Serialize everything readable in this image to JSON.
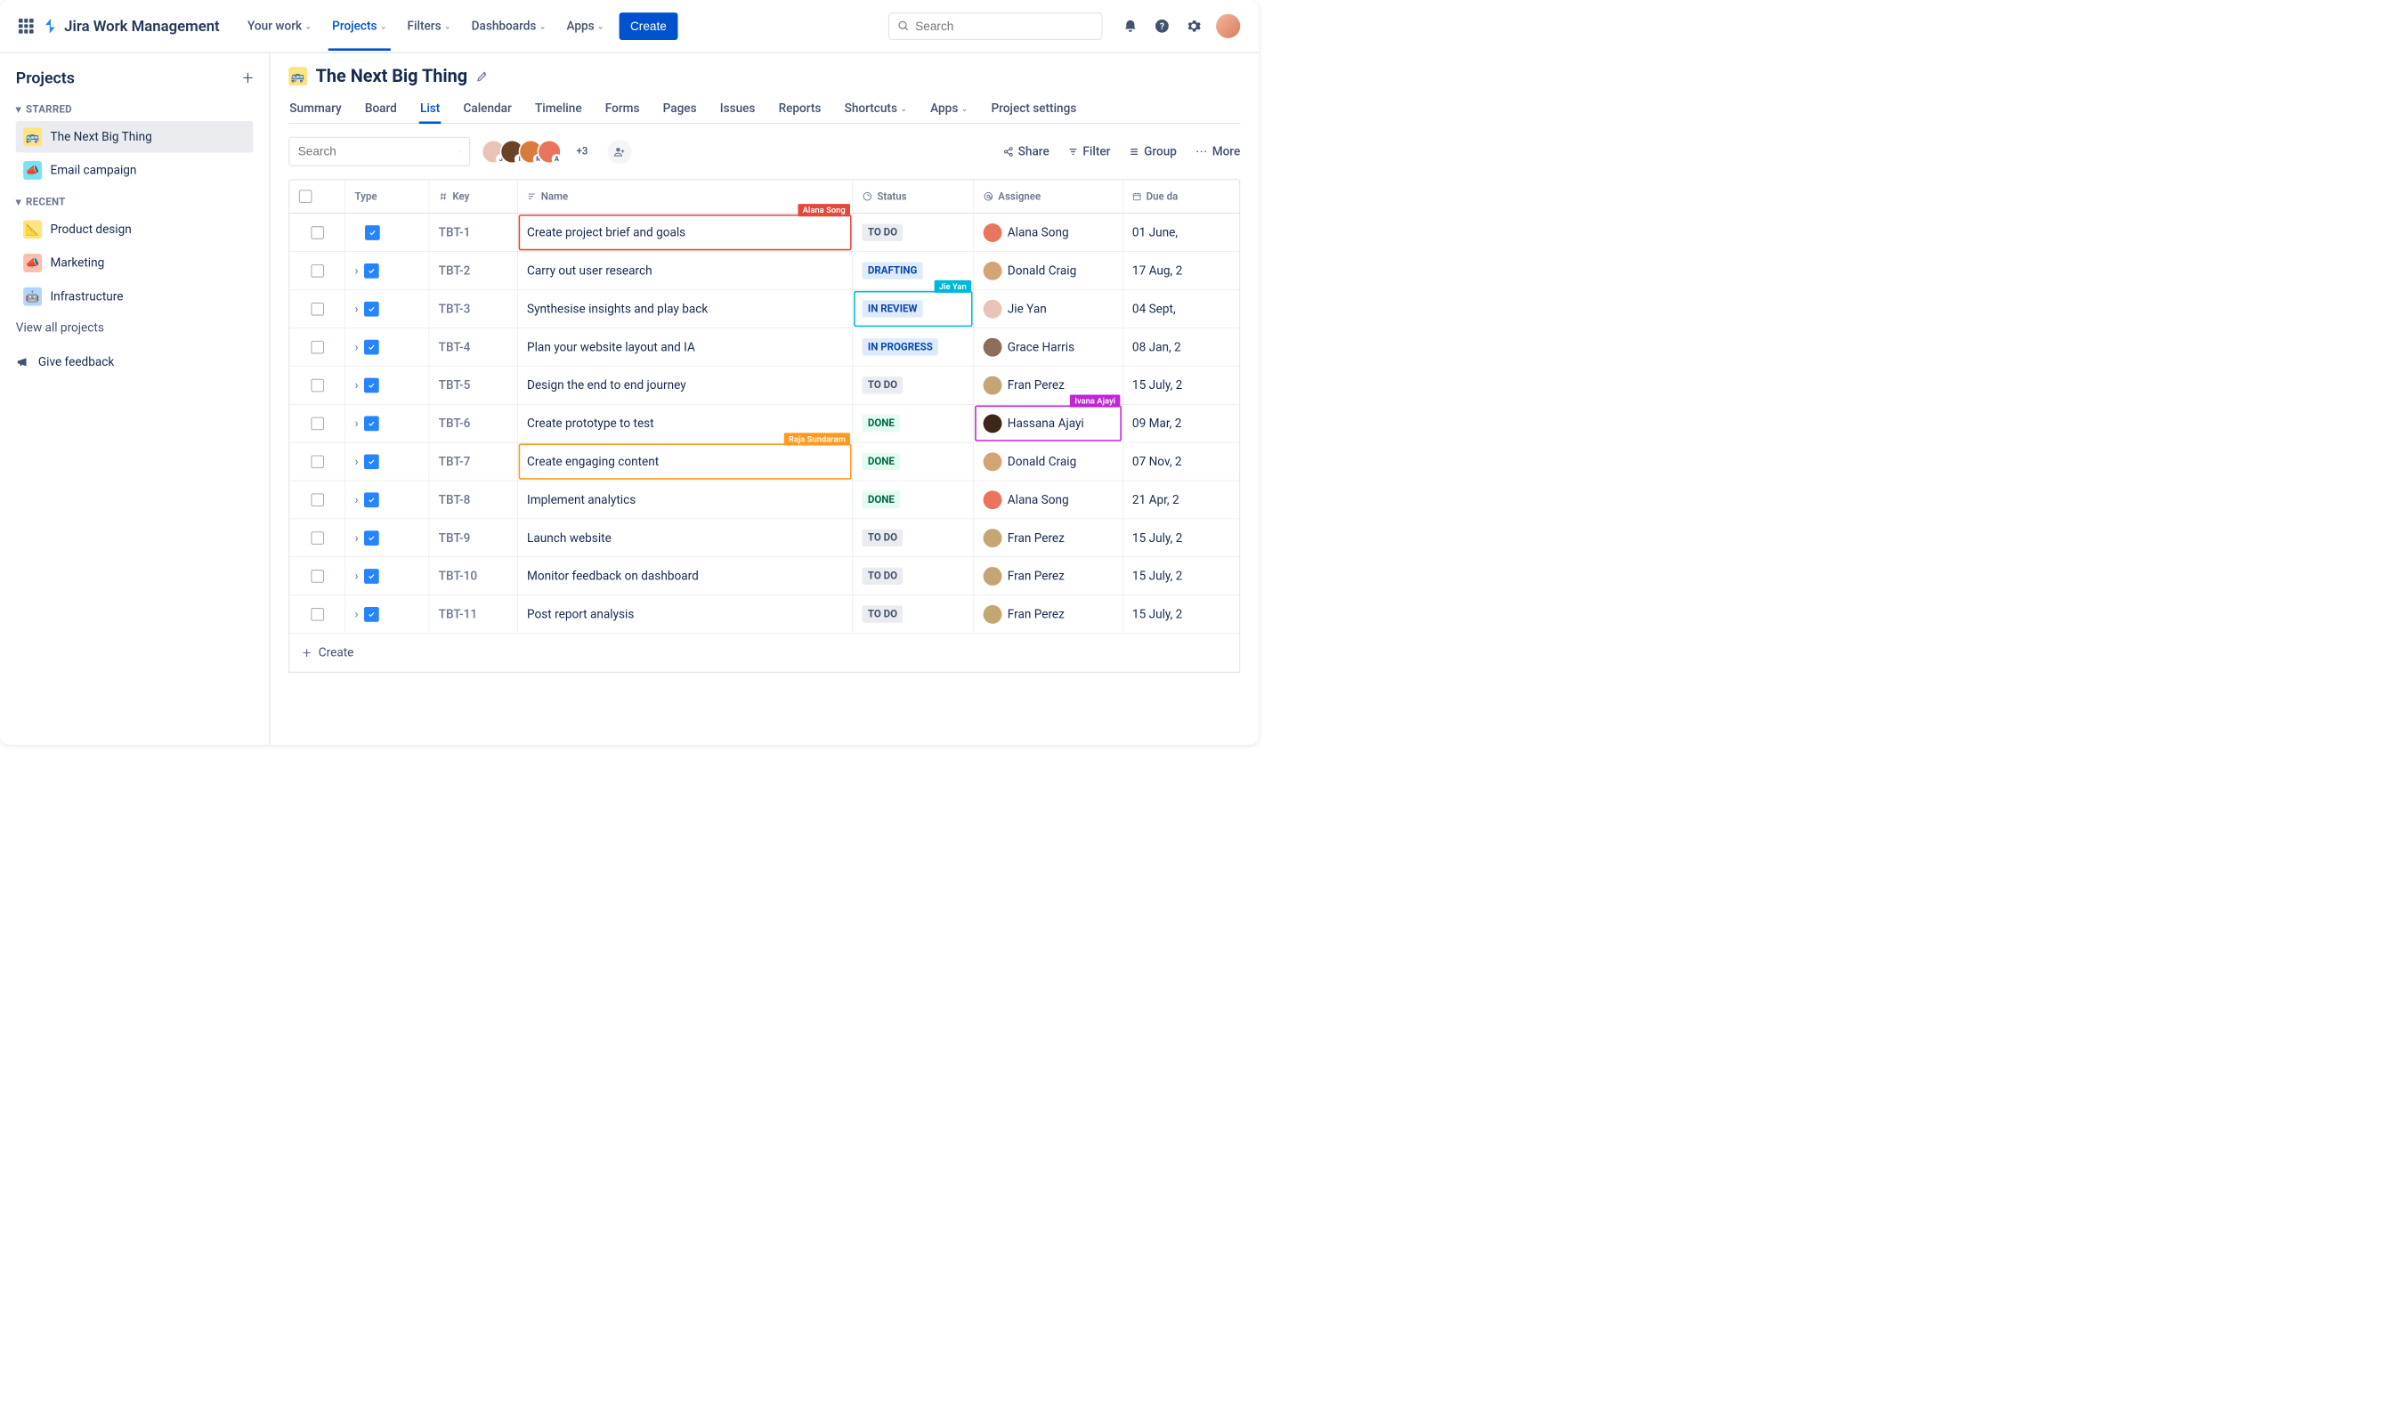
{
  "brand": "Jira Work Management",
  "nav": {
    "items": [
      "Your work",
      "Projects",
      "Filters",
      "Dashboards",
      "Apps"
    ],
    "activeIndex": 1,
    "create": "Create",
    "searchPlaceholder": "Search"
  },
  "sidebar": {
    "title": "Projects",
    "starredLabel": "STARRED",
    "recentLabel": "RECENT",
    "starred": [
      {
        "name": "The Next Big Thing",
        "selected": true,
        "iconClass": "pi-yellow",
        "emoji": "🚌"
      },
      {
        "name": "Email campaign",
        "selected": false,
        "iconClass": "pi-teal",
        "emoji": "📣"
      }
    ],
    "recent": [
      {
        "name": "Product design",
        "iconClass": "pi-yellow",
        "emoji": "📐"
      },
      {
        "name": "Marketing",
        "iconClass": "pi-pink",
        "emoji": "📣"
      },
      {
        "name": "Infrastructure",
        "iconClass": "pi-blue",
        "emoji": "🤖"
      }
    ],
    "viewAll": "View all projects",
    "feedback": "Give feedback"
  },
  "project": {
    "title": "The Next Big Thing",
    "tabs": [
      "Summary",
      "Board",
      "List",
      "Calendar",
      "Timeline",
      "Forms",
      "Pages",
      "Issues",
      "Reports",
      "Shortcuts",
      "Apps",
      "Project settings"
    ],
    "activeTab": 2,
    "dropdownTabs": [
      9,
      10
    ],
    "avatarOverflow": "+3",
    "searchPlaceholder": "Search"
  },
  "toolbar": {
    "share": "Share",
    "filter": "Filter",
    "group": "Group",
    "more": "More"
  },
  "avatars": [
    {
      "letter": "J",
      "bg": "#E8C4B8"
    },
    {
      "letter": "I",
      "bg": "#6B4226"
    },
    {
      "letter": "R",
      "bg": "#D97B3A"
    },
    {
      "letter": "A",
      "bg": "#E8755C"
    }
  ],
  "columns": {
    "type": "Type",
    "key": "Key",
    "name": "Name",
    "status": "Status",
    "assignee": "Assignee",
    "due": "Due da"
  },
  "rows": [
    {
      "key": "TBT-1",
      "name": "Create project brief and goals",
      "status": "TO DO",
      "statusClass": "st-todo",
      "assignee": "Alana Song",
      "avBg": "#E8755C",
      "due": "01 June,",
      "expand": false
    },
    {
      "key": "TBT-2",
      "name": "Carry out user research",
      "status": "DRAFTING",
      "statusClass": "st-drafting",
      "assignee": "Donald Craig",
      "avBg": "#D4A574",
      "due": "17 Aug, 2",
      "expand": true
    },
    {
      "key": "TBT-3",
      "name": "Synthesise insights and play back",
      "status": "IN REVIEW",
      "statusClass": "st-review",
      "assignee": "Jie Yan",
      "avBg": "#E8C4B8",
      "due": "04 Sept,",
      "expand": true
    },
    {
      "key": "TBT-4",
      "name": "Plan your website layout and IA",
      "status": "IN PROGRESS",
      "statusClass": "st-progress",
      "assignee": "Grace Harris",
      "avBg": "#8B6F5C",
      "due": "08 Jan, 2",
      "expand": true
    },
    {
      "key": "TBT-5",
      "name": "Design the end to end journey",
      "status": "TO DO",
      "statusClass": "st-todo",
      "assignee": "Fran Perez",
      "avBg": "#C4A574",
      "due": "15 July, 2",
      "expand": true
    },
    {
      "key": "TBT-6",
      "name": "Create prototype to test",
      "status": "DONE",
      "statusClass": "st-done",
      "assignee": "Hassana Ajayi",
      "avBg": "#3D2817",
      "due": "09 Mar, 2",
      "expand": true
    },
    {
      "key": "TBT-7",
      "name": "Create engaging content",
      "status": "DONE",
      "statusClass": "st-done",
      "assignee": "Donald Craig",
      "avBg": "#D4A574",
      "due": "07 Nov, 2",
      "expand": true
    },
    {
      "key": "TBT-8",
      "name": "Implement analytics",
      "status": "DONE",
      "statusClass": "st-done",
      "assignee": "Alana Song",
      "avBg": "#E8755C",
      "due": "21 Apr, 2",
      "expand": true
    },
    {
      "key": "TBT-9",
      "name": "Launch website",
      "status": "TO DO",
      "statusClass": "st-todo",
      "assignee": "Fran Perez",
      "avBg": "#C4A574",
      "due": "15 July, 2",
      "expand": true
    },
    {
      "key": "TBT-10",
      "name": "Monitor feedback on dashboard",
      "status": "TO DO",
      "statusClass": "st-todo",
      "assignee": "Fran Perez",
      "avBg": "#C4A574",
      "due": "15 July, 2",
      "expand": true
    },
    {
      "key": "TBT-11",
      "name": "Post report analysis",
      "status": "TO DO",
      "statusClass": "st-todo",
      "assignee": "Fran Perez",
      "avBg": "#C4A574",
      "due": "15 July, 2",
      "expand": true
    }
  ],
  "highlights": [
    {
      "row": 0,
      "target": "name",
      "color": "#E2483D",
      "label": "Alana Song"
    },
    {
      "row": 2,
      "target": "status",
      "color": "#00B8D9",
      "label": "Jie Yan"
    },
    {
      "row": 5,
      "target": "assignee",
      "color": "#C026D3",
      "label": "Ivana Ajayi"
    },
    {
      "row": 6,
      "target": "name",
      "color": "#FF991F",
      "label": "Raja Sundaram"
    }
  ],
  "createRow": "Create"
}
